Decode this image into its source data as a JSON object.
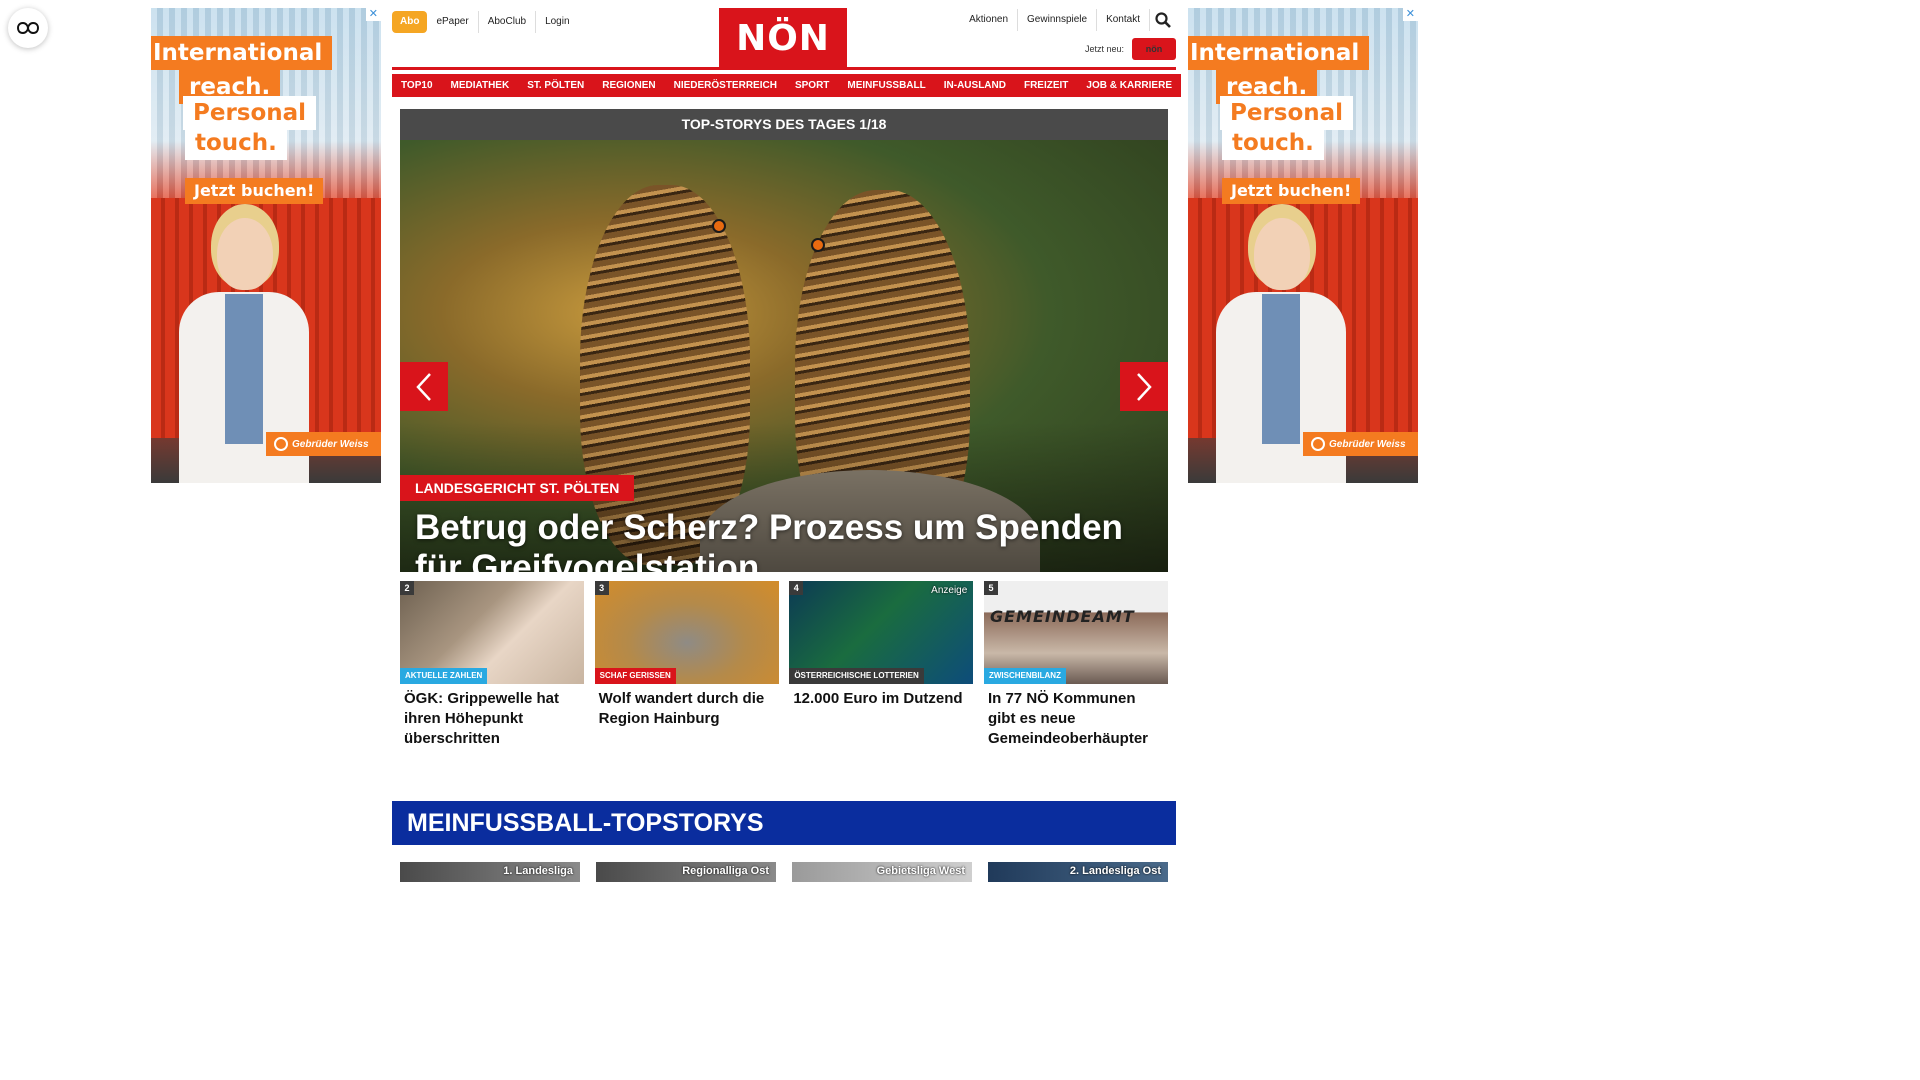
{
  "ads": {
    "line1": "International",
    "line2": "reach.",
    "line3": "Personal",
    "line4": "touch.",
    "cta": "Jetzt buchen!",
    "brand": "Gebrüder Weiss",
    "close": "✕",
    "colors": {
      "orange": "#f47b20",
      "container_red": "#d7381f"
    }
  },
  "header": {
    "abo": "Abo",
    "left_links": [
      "ePaper",
      "AboClub",
      "Login"
    ],
    "logo": "NÖN",
    "right_links": [
      "Aktionen",
      "Gewinnspiele",
      "Kontakt"
    ],
    "jetzt_neu": "Jetzt neu:",
    "mini_logo": "nön",
    "search_icon": "search-icon"
  },
  "nav": [
    "TOP10",
    "MEDIATHEK",
    "ST. PÖLTEN",
    "REGIONEN",
    "NIEDERÖSTERREICH",
    "SPORT",
    "MEINFUSSBALL",
    "IN-AUSLAND",
    "FREIZEIT",
    "JOB & KARRIERE"
  ],
  "hero": {
    "header": "TOP-STORYS DES TAGES 1/18",
    "kicker": "LANDESGERICHT ST. PÖLTEN",
    "title": "Betrug oder Scherz? Prozess um Spenden für Greifvogelstation"
  },
  "cards": [
    {
      "num": "2",
      "kicker": "AKTUELLE ZAHLEN",
      "title": "ÖGK: Grippewelle hat ihren Höhepunkt überschritten"
    },
    {
      "num": "3",
      "kicker": "SCHAF GERISSEN",
      "title": "Wolf wandert durch die Region Hainburg"
    },
    {
      "num": "4",
      "anzeige": "Anzeige",
      "kicker": "ÖSTERREICHISCHE LOTTERIEN",
      "title": "12.000 Euro im Dutzend"
    },
    {
      "num": "5",
      "kicker": "ZWISCHENBILANZ",
      "title": "In 77 NÖ Kommunen gibt es neue Gemeindeoberhäupter",
      "image_text": "GEMEINDEAMT"
    }
  ],
  "meinfussball": {
    "title": "MEINFUSSBALL-TOPSTORYS",
    "cards": [
      "1. Landesliga",
      "Regionalliga Ost",
      "Gebietsliga West",
      "2. Landesliga Ost"
    ]
  },
  "colors": {
    "brand_red": "#d9141b",
    "abo_orange": "#f5a623",
    "mf_blue": "#0a2d9e",
    "kicker_blue": "#29a9e1"
  }
}
